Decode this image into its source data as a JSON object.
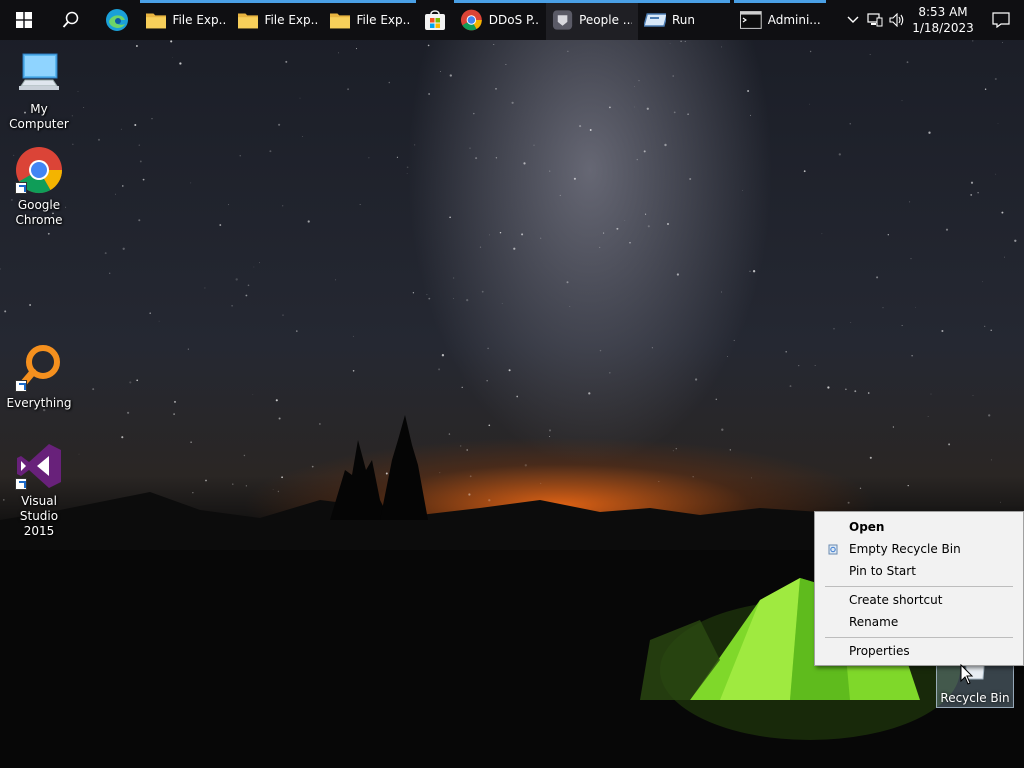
{
  "taskbar": {
    "apps": [
      {
        "label": "File Exp...",
        "icon": "folder-icon"
      },
      {
        "label": "File Exp...",
        "icon": "folder-icon"
      },
      {
        "label": "File Exp...",
        "icon": "folder-icon"
      },
      {
        "label": "DDoS P...",
        "icon": "chrome-icon"
      },
      {
        "label": "People ...",
        "icon": "people-icon"
      },
      {
        "label": "Run",
        "icon": "run-icon"
      },
      {
        "label": "Admini...",
        "icon": "terminal-icon"
      }
    ],
    "clock_time": "8:53 AM",
    "clock_date": "1/18/2023"
  },
  "desktop": {
    "icons": [
      {
        "label": "My Computer"
      },
      {
        "label": "Google\nChrome"
      },
      {
        "label": "Everything"
      },
      {
        "label": "Visual Studio\n2015"
      }
    ],
    "recycle_bin_label": "Recycle Bin"
  },
  "context_menu": {
    "items": [
      {
        "label": "Open"
      },
      {
        "label": "Empty Recycle Bin"
      },
      {
        "label": "Pin to Start"
      },
      {
        "label": "Create shortcut"
      },
      {
        "label": "Rename"
      },
      {
        "label": "Properties"
      }
    ]
  },
  "colors": {
    "taskbar": "#0f0f12",
    "accent": "#4aa0e6",
    "menu_bg": "#f2f2f2"
  }
}
